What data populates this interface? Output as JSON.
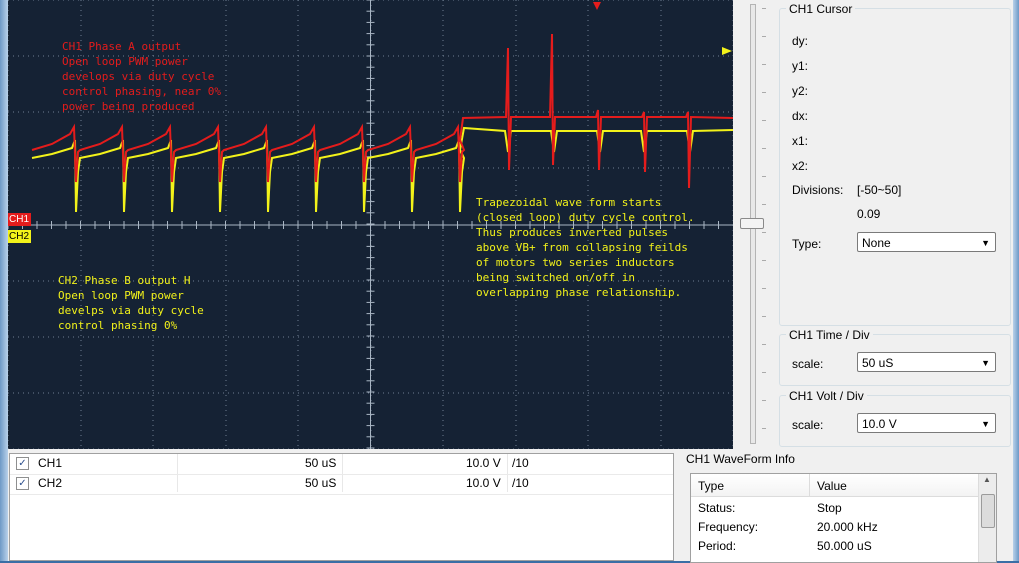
{
  "scope": {
    "notes": {
      "ch1": "CH1 Phase A output\nOpen loop PWM power\ndevelops via duty cycle\ncontrol phasing, near 0%\npower being produced",
      "ch2": "CH2 Phase B output H\nOpen loop PWM power\ndevelps via duty cycle\ncontrol phasing 0%",
      "trap": "Trapezoidal wave form starts\n(closed loop) duty cycle control.\nThus produces inverted pulses\nabove VB+ from collapsing feilds\nof motors two series inductors\nbeing switched on/off in\noverlapping phase relationship."
    },
    "markers": {
      "ch1": "CH1",
      "ch2": "CH2"
    },
    "colors": {
      "background": "#152234",
      "ch1": "#e41c1c",
      "ch2": "#f2f21a",
      "grid": "#6f7f92"
    }
  },
  "cursor": {
    "title": "CH1 Cursor",
    "dy": "dy:",
    "y1": "y1:",
    "y2": "y2:",
    "dx": "dx:",
    "x1": "x1:",
    "x2": "x2:",
    "divisions_label": "Divisions:",
    "divisions_range": "[-50~50]",
    "divisions_value": "0.09",
    "type_label": "Type:",
    "type_value": "None"
  },
  "time_div": {
    "title": "CH1 Time / Div",
    "scale_label": "scale:",
    "scale_value": "50 uS"
  },
  "volt_div": {
    "title": "CH1 Volt / Div",
    "scale_label": "scale:",
    "scale_value": "10.0 V"
  },
  "channels": [
    {
      "name": "CH1",
      "time": "50 uS",
      "volt": "10.0 V",
      "ratio": "/10",
      "checked": "✓"
    },
    {
      "name": "CH2",
      "time": "50 uS",
      "volt": "10.0 V",
      "ratio": "/10",
      "checked": "✓"
    }
  ],
  "waveform_info": {
    "title": "CH1 WaveForm Info",
    "col_type": "Type",
    "col_value": "Value",
    "rows": [
      {
        "type": "Status:",
        "value": "Stop"
      },
      {
        "type": "Frequency:",
        "value": "20.000 kHz"
      },
      {
        "type": "Period:",
        "value": "50.000 uS"
      }
    ]
  }
}
